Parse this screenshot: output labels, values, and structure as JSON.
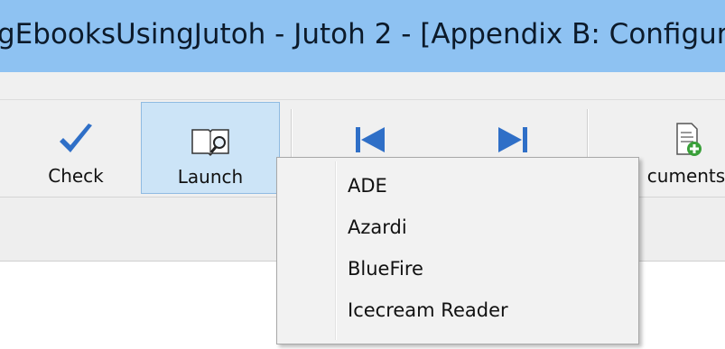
{
  "window": {
    "title": "gEbooksUsingJutoh - Jutoh 2 - [Appendix B: Configur"
  },
  "toolbar": {
    "check_label": "Check",
    "launch_label": "Launch",
    "documents_label": "cuments"
  },
  "launch_menu": {
    "items": [
      {
        "label": "ADE"
      },
      {
        "label": "Azardi"
      },
      {
        "label": "BlueFire"
      },
      {
        "label": "Icecream Reader"
      }
    ]
  },
  "colors": {
    "title_bar": "#8ec2f2",
    "toolbar_bg": "#f0f0f0",
    "launch_highlight": "#cce4f7",
    "check_icon": "#2f6fc7",
    "nav_icon": "#2f6fc7",
    "menu_bg": "#f2f2f2"
  },
  "icons": {
    "check": "checkmark-icon",
    "launch": "book-magnifier-icon",
    "previous": "skip-previous-icon",
    "next": "skip-next-icon",
    "documents": "add-document-icon"
  }
}
